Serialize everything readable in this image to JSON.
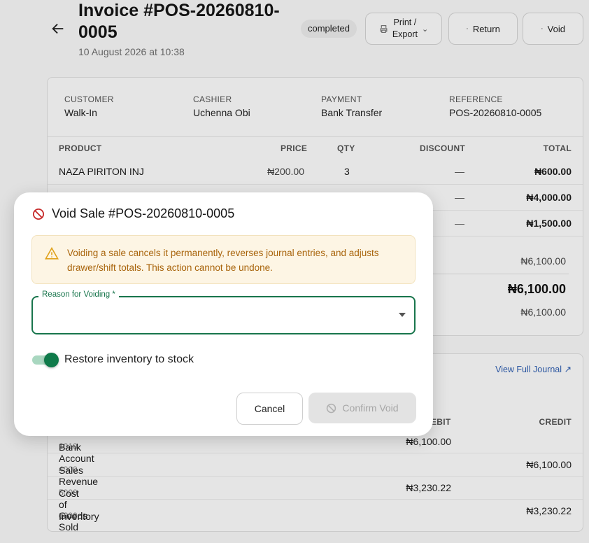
{
  "header": {
    "title": "Invoice #POS-20260810-0005",
    "date": "10 August 2026 at 10:38",
    "status": "completed",
    "print_label_1": "Print /",
    "print_label_2": "Export",
    "return_label": "Return",
    "void_label": "Void"
  },
  "meta": [
    {
      "label": "CUSTOMER",
      "value": "Walk-In"
    },
    {
      "label": "CASHIER",
      "value": "Uchenna Obi"
    },
    {
      "label": "PAYMENT",
      "value": "Bank Transfer"
    },
    {
      "label": "REFERENCE",
      "value": "POS-20260810-0005"
    }
  ],
  "items": {
    "headers": {
      "product": "PRODUCT",
      "price": "PRICE",
      "qty": "QTY",
      "discount": "DISCOUNT",
      "total": "TOTAL"
    },
    "rows": [
      {
        "product": "NAZA PIRITON INJ",
        "price": "₦200.00",
        "qty": "3",
        "discount": "—",
        "total": "₦600.00"
      },
      {
        "product": "",
        "price": "",
        "qty": "",
        "discount": "—",
        "total": "₦4,000.00"
      },
      {
        "product": "",
        "price": "",
        "qty": "",
        "discount": "—",
        "total": "₦1,500.00"
      }
    ]
  },
  "totals": {
    "subtotal": "₦6,100.00",
    "grand_total": "₦6,100.00",
    "paid": "₦6,100.00"
  },
  "journal": {
    "link": "View Full Journal",
    "debit_header": "EBIT",
    "credit_header": "CREDIT",
    "rows": [
      {
        "code": "1010",
        "account": "Bank Account",
        "debit": "₦6,100.00",
        "credit": ""
      },
      {
        "code": "4000",
        "account": "Sales Revenue",
        "debit": "",
        "credit": "₦6,100.00"
      },
      {
        "code": "5000",
        "account": "Cost of Goods Sold",
        "debit": "₦3,230.22",
        "credit": ""
      },
      {
        "code": "1200",
        "account": "Inventory",
        "debit": "",
        "credit": "₦3,230.22"
      }
    ]
  },
  "modal": {
    "title": "Void Sale #POS-20260810-0005",
    "warning": "Voiding a sale cancels it permanently, reverses journal entries, and adjusts drawer/shift totals. This action cannot be undone.",
    "reason_label": "Reason for Voiding *",
    "reason_value": "",
    "restore_label": "Restore inventory to stock",
    "restore_checked": true,
    "cancel_label": "Cancel",
    "confirm_label": "Confirm Void"
  },
  "colors": {
    "accent": "#18754c",
    "warning_bg": "#fdf5e4",
    "warning_text": "#a8630a",
    "danger": "#c62828"
  }
}
